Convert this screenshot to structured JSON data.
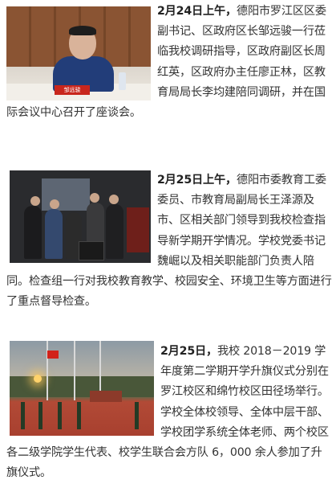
{
  "articles": [
    {
      "date_label": "2月24日上午，",
      "body": "德阳市罗江区区委副书记、区政府区长邹远骏一行莅临我校调研指导，区政府副区长周红英，区政府办主任廖正林，区教育局局长李均建陪同调研，并在国际会议中心召开了座谈会。"
    },
    {
      "date_label": "2月25日上午，",
      "body": "德阳市委教育工委委员、市教育局副局长王泽源及市、区相关部门领导到我校检查指导新学期开学情况。学校党委书记魏崛以及相关职能部门负责人陪同。检查组一行对我校教育教学、校园安全、环境卫生等方面进行了重点督导检查。"
    },
    {
      "date_label": "2月25日，",
      "body": "我校 2018－2019 学年度第二学期开学升旗仪式分别在罗江校区和绵竹校区田径场举行。学校全体校领导、全体中层干部、学校团学系统全体老师、两个校区各二级学院学生代表、校学生联合会方队 6，000 余人参加了升旗仪式。"
    }
  ],
  "photo1": {
    "nameplate": "邹远骏"
  },
  "colors": {
    "text": "#333333",
    "accent_red": "#c8261d",
    "background": "#ffffff"
  }
}
